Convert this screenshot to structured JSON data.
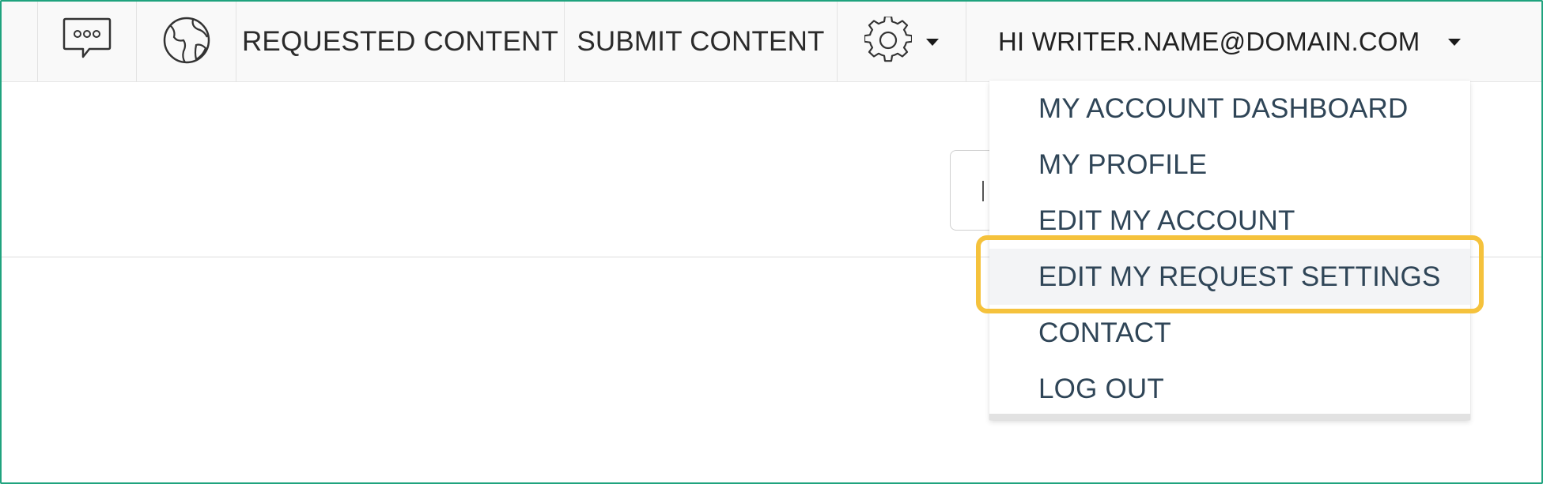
{
  "nav": {
    "chat_icon": "speech-bubble-icon",
    "globe_icon": "globe-icon",
    "requested_content": "REQUESTED CONTENT",
    "submit_content": "SUBMIT CONTENT",
    "settings_icon": "gear-icon",
    "user_greeting": "HI WRITER.NAME@DOMAIN.COM"
  },
  "user_menu": {
    "items": [
      {
        "label": "MY ACCOUNT DASHBOARD"
      },
      {
        "label": "MY PROFILE"
      },
      {
        "label": "EDIT MY ACCOUNT"
      },
      {
        "label": "EDIT MY REQUEST SETTINGS",
        "highlighted": true
      },
      {
        "label": "CONTACT"
      },
      {
        "label": "LOG OUT"
      }
    ]
  },
  "colors": {
    "frame_border": "#1fa37e",
    "highlight": "#f5c23c",
    "menu_text": "#2f4557"
  }
}
